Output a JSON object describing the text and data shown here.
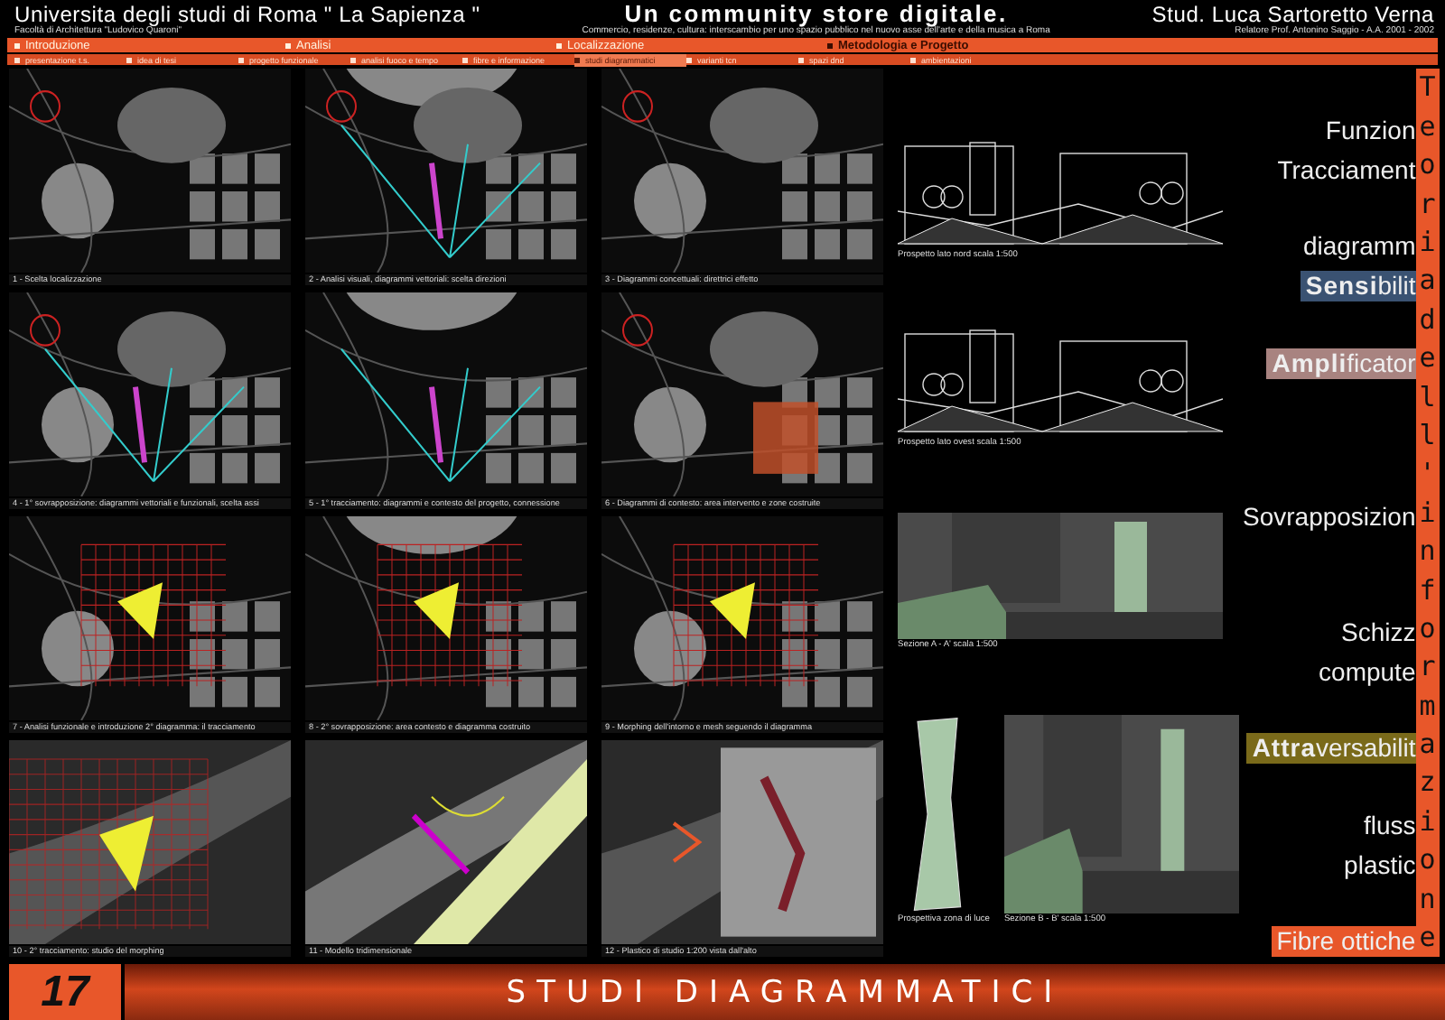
{
  "header": {
    "university": "Universita degli studi di Roma \" La Sapienza \"",
    "faculty": "Facoltà di Architettura \"Ludovico Quaroni\"",
    "title": "Un community store digitale.",
    "subtitle": "Commercio, residenze, cultura: interscambio per uno spazio pubblico nel nuovo asse dell'arte e della musica a Roma",
    "student": "Stud. Luca Sartoretto Verna",
    "advisor": "Relatore Prof. Antonino Saggio - A.A. 2001 - 2002"
  },
  "nav": [
    {
      "label": "Introduzione",
      "selected": false
    },
    {
      "label": "Analisi",
      "selected": false
    },
    {
      "label": "Localizzazione",
      "selected": false
    },
    {
      "label": "Metodologia e Progetto",
      "selected": true
    }
  ],
  "subnav": [
    {
      "label": "presentazione t.s.",
      "selected": false
    },
    {
      "label": "idea di tesi",
      "selected": false
    },
    {
      "label": "progetto funzionale",
      "selected": false
    },
    {
      "label": "analisi fuoco e tempo",
      "selected": false
    },
    {
      "label": "fibre e informazione",
      "selected": false
    },
    {
      "label": "studi diagrammatici",
      "selected": true
    },
    {
      "label": "varianti tcn",
      "selected": false
    },
    {
      "label": "spazi dnd",
      "selected": false
    },
    {
      "label": "ambientazioni",
      "selected": false
    }
  ],
  "maps": [
    {
      "caption": "1 - Scelta localizzazione"
    },
    {
      "caption": "2 - Analisi visuali, diagrammi vettoriali: scelta direzioni"
    },
    {
      "caption": "3 - Diagrammi concettuali: direttrici effetto"
    },
    {
      "caption": "4 - 1° sovrapposizione: diagrammi vettoriali e funzionali, scelta assi"
    },
    {
      "caption": "5 - 1° tracciamento: diagrammi e contesto del progetto, connessione"
    },
    {
      "caption": "6 - Diagrammi di contesto: area intervento e zone costruite"
    },
    {
      "caption": "7 - Analisi funzionale e introduzione 2° diagramma: il tracciamento"
    },
    {
      "caption": "8 - 2° sovrapposizione: area contesto e diagramma costruito"
    },
    {
      "caption": "9 - Morphing dell'intorno e mesh seguendo il diagramma"
    },
    {
      "caption": "10 - 2° tracciamento: studio del morphing"
    },
    {
      "caption": "11 - Modello tridimensionale"
    },
    {
      "caption": "12 - Plastico di studio 1:200 vista dall'alto"
    }
  ],
  "drawings": [
    {
      "kind": "elevation",
      "caption": "Prospetto lato nord scala 1:500"
    },
    {
      "kind": "elevation",
      "caption": "Prospetto lato ovest scala 1:500"
    },
    {
      "kind": "render",
      "caption": "Sezione A - A' scala 1:500"
    },
    {
      "kind": "tower",
      "caption": "Prospettiva zona di luce"
    },
    {
      "kind": "render",
      "caption": "Sezione B - B' scala 1:500"
    }
  ],
  "side_labels": [
    {
      "text": "Funzion",
      "kind": "plain"
    },
    {
      "text": "Tracciament",
      "kind": "plain"
    },
    {
      "text": "diagramm",
      "kind": "plain"
    },
    {
      "text": "**Sensi**bilit",
      "kind": "highlight",
      "color": "#3a5272"
    },
    {
      "text": "**Ampli**ficator",
      "kind": "highlight",
      "color": "#a88380"
    },
    {
      "text": "Sovrapposizion",
      "kind": "plain"
    },
    {
      "text": "Schizz",
      "kind": "plain"
    },
    {
      "text": "compute",
      "kind": "plain"
    },
    {
      "text": "**Attra**versabilit",
      "kind": "highlight",
      "color": "#7a6a1a"
    },
    {
      "text": "fluss",
      "kind": "plain"
    },
    {
      "text": "plastic",
      "kind": "plain"
    },
    {
      "text": "Fibre ottiche",
      "kind": "highlight",
      "color": "#e8572a"
    }
  ],
  "vertical_title": "Teoria dell'informazione",
  "footer": {
    "page": "17",
    "title": "STUDI DIAGRAMMATICI"
  }
}
